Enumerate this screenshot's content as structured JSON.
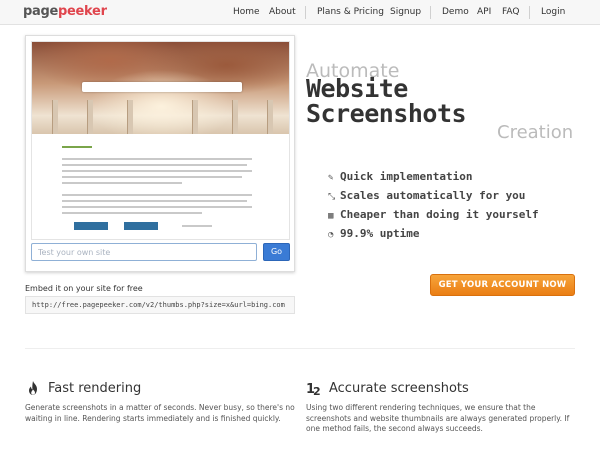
{
  "nav": {
    "logo_part1": "page",
    "logo_part2": "peeker",
    "links": [
      "Home",
      "About",
      "Plans & Pricing",
      "Signup",
      "Demo",
      "API",
      "FAQ",
      "Login"
    ]
  },
  "preview": {
    "input_placeholder": "Test your own site",
    "go_label": "Go",
    "embed_label": "Embed it on your site for free",
    "embed_code": "http://free.pagepeeker.com/v2/thumbs.php?size=x&url=bing.com"
  },
  "hero": {
    "line1": "Automate",
    "line2": "Website",
    "line3": "Screenshots",
    "line4": "Creation",
    "features": [
      {
        "icon": "pencil-icon",
        "glyph": "✎",
        "text": "Quick implementation"
      },
      {
        "icon": "arrows-icon",
        "glyph": "⤡",
        "text": "Scales automatically for you"
      },
      {
        "icon": "grid-icon",
        "glyph": "▦",
        "text": "Cheaper than doing it yourself"
      },
      {
        "icon": "gauge-icon",
        "glyph": "◔",
        "text": "99.9% uptime"
      }
    ],
    "cta_label": "GET YOUR ACCOUNT NOW"
  },
  "benefits": [
    {
      "icon": "flame-icon",
      "title": "Fast rendering",
      "text": "Generate screenshots in a matter of seconds. Never busy, so there's no waiting in line. Rendering starts immediately and is finished quickly."
    },
    {
      "icon": "one-two-icon",
      "title": "Accurate screenshots",
      "text": "Using two different rendering techniques, we ensure that the screenshots and website thumbnails are always generated properly. If one method fails, the second always succeeds."
    }
  ],
  "colors": {
    "brand_red": "#e0454d",
    "cta_orange": "#f0901f",
    "go_blue": "#3a7bd5"
  }
}
